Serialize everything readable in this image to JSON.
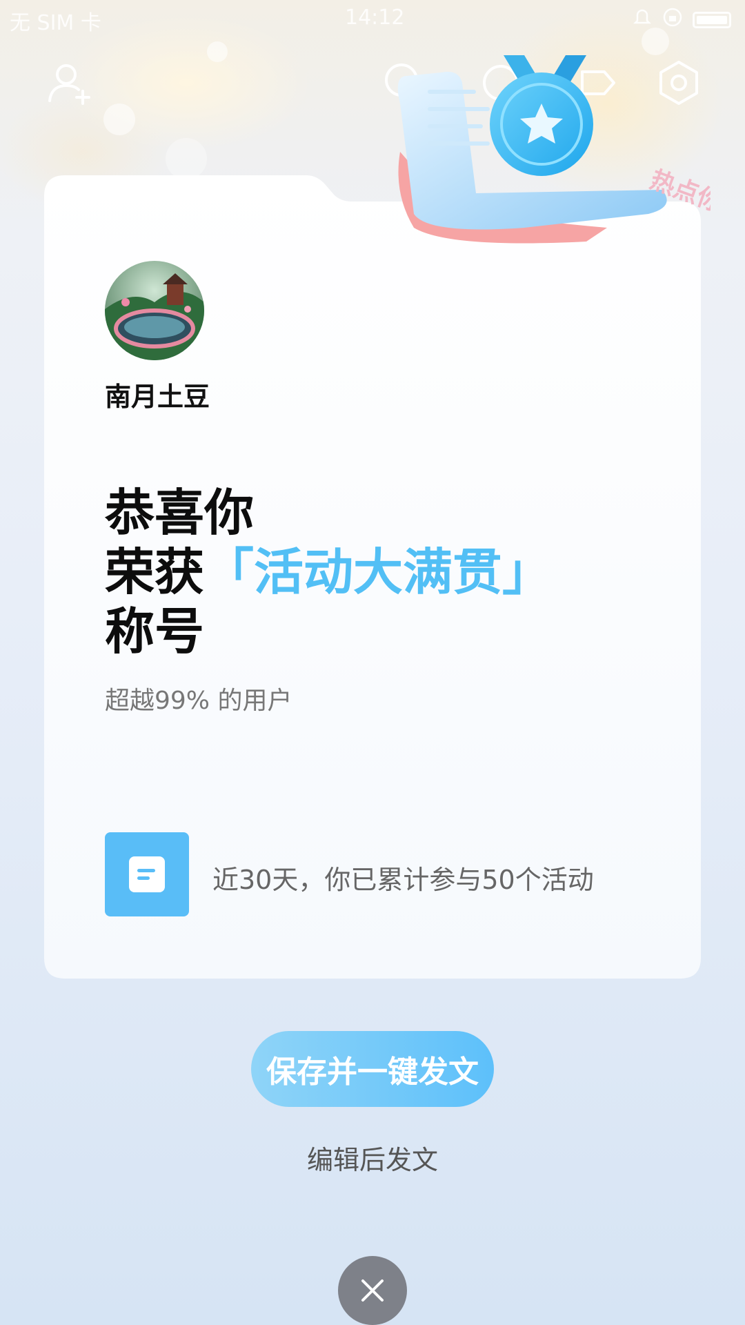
{
  "status_bar": {
    "carrier": "无 SIM 卡",
    "time": "14:12"
  },
  "toolbar": {
    "icons": [
      "add-user-icon",
      "search-icon",
      "chat-icon",
      "share-icon",
      "settings-icon"
    ]
  },
  "badge_art": {
    "watermark_text": "热点你"
  },
  "card": {
    "username": "南月土豆",
    "congrats_line1": "恭喜你",
    "congrats_line2_prefix": "荣获",
    "title_name": "「活动大满贯」",
    "congrats_line3": "称号",
    "subtitle": "超越99% 的用户",
    "stat_text": "近30天，你已累计参与50个活动"
  },
  "actions": {
    "save_post": "保存并一键发文",
    "edit_post": "编辑后发文"
  },
  "colors": {
    "accent": "#52bff5",
    "button_gradient_start": "#8fd4f8",
    "button_gradient_end": "#5dc0fa",
    "close_bg": "#6e7076"
  }
}
